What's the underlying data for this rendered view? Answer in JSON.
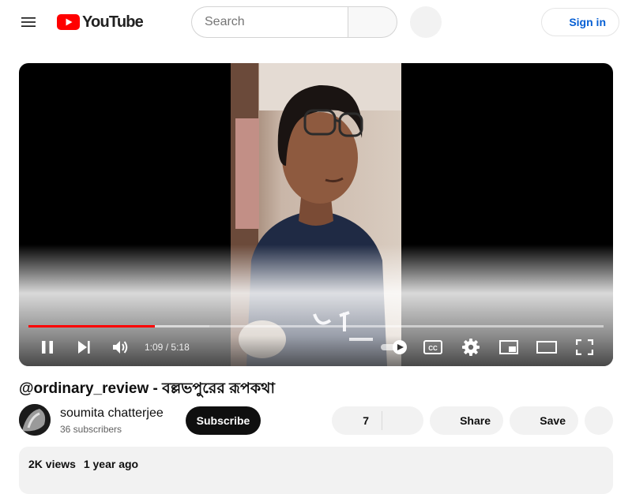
{
  "header": {
    "menu_icon": "hamburger-menu-icon",
    "logo_text": "YouTube",
    "logo_color": "#ff0000",
    "search_placeholder": "Search",
    "search_icon": "search-icon",
    "voice_icon": "microphone-icon",
    "signin_label": "Sign in",
    "signin_icon": "account-circle-icon",
    "accent_color": "#065fd4"
  },
  "player": {
    "current_time": "1:09",
    "duration": "5:18",
    "time_separator": "/",
    "progress_played_fraction": 0.22,
    "progress_loaded_fraction": 0.315,
    "progress_color": "#ff0000",
    "autoplay_on": true,
    "controls": [
      "pause-icon",
      "next-icon",
      "volume-icon",
      "autoplay-toggle",
      "captions-icon",
      "settings-icon",
      "miniplayer-icon",
      "theater-mode-icon",
      "fullscreen-icon"
    ]
  },
  "video": {
    "title": "@ordinary_review - বল্লভপুরের রূপকথা"
  },
  "channel": {
    "name": "soumita chatterjee",
    "subscribers": "36 subscribers",
    "subscribe_label": "Subscribe"
  },
  "actions": {
    "like_count": "7",
    "like_icon": "thumbs-up-icon",
    "dislike_icon": "thumbs-down-icon",
    "share_label": "Share",
    "share_icon": "share-icon",
    "save_label": "Save",
    "save_icon": "playlist-add-icon",
    "more_icon": "more-horizontal-icon"
  },
  "description": {
    "views": "2K views",
    "age": "1 year ago"
  }
}
